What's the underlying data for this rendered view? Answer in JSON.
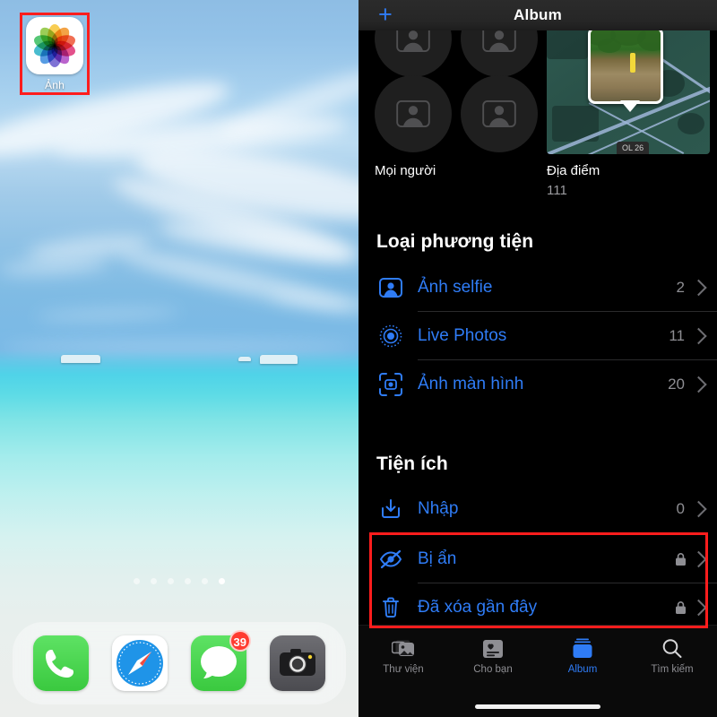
{
  "home_screen": {
    "app_icon": {
      "name": "photos-app-icon",
      "label": "Ảnh"
    },
    "highlight_color": "#ff1d1d",
    "page_dots": {
      "total": 6,
      "active_index": 5
    },
    "dock": {
      "items": [
        {
          "name": "phone",
          "icon": "phone-icon",
          "badge": ""
        },
        {
          "name": "safari",
          "icon": "safari-compass-icon",
          "badge": ""
        },
        {
          "name": "messages",
          "icon": "messages-bubble-icon",
          "badge": "39"
        },
        {
          "name": "camera",
          "icon": "camera-icon",
          "badge": ""
        }
      ]
    },
    "wallpaper": {
      "description": "beach-sea-sky",
      "sky_color": "#8ebde4",
      "sea_color": "#4fd3e8",
      "sand_color": "#eceeec"
    }
  },
  "photos_app": {
    "nav": {
      "add_label": "+",
      "title": "Album"
    },
    "top_albums": [
      {
        "name": "people-album",
        "caption": "Mọi người",
        "count": ""
      },
      {
        "name": "places-album",
        "caption": "Địa điểm",
        "count": "111",
        "map_label": "OL 26"
      }
    ],
    "sections": [
      {
        "name": "media-types",
        "title": "Loại phương tiện",
        "rows": [
          {
            "icon": "selfie-icon",
            "label": "Ảnh selfie",
            "count": "2",
            "locked": false
          },
          {
            "icon": "live-photo-icon",
            "label": "Live Photos",
            "count": "11",
            "locked": false
          },
          {
            "icon": "screenshot-icon",
            "label": "Ảnh màn hình",
            "count": "20",
            "locked": false
          }
        ]
      },
      {
        "name": "utilities",
        "title": "Tiện ích",
        "rows": [
          {
            "icon": "import-icon",
            "label": "Nhập",
            "count": "0",
            "locked": false
          },
          {
            "icon": "eye-slash-icon",
            "label": "Bị ẩn",
            "count": "",
            "locked": true
          },
          {
            "icon": "trash-icon",
            "label": "Đã xóa gần đây",
            "count": "",
            "locked": true
          }
        ]
      }
    ],
    "accent_color": "#2f7cf6",
    "tabs": [
      {
        "name": "library",
        "label": "Thư viện",
        "icon": "photo-stack-icon",
        "active": false
      },
      {
        "name": "for-you",
        "label": "Cho bạn",
        "icon": "for-you-card-icon",
        "active": false
      },
      {
        "name": "albums",
        "label": "Album",
        "icon": "albums-stack-icon",
        "active": true
      },
      {
        "name": "search",
        "label": "Tìm kiếm",
        "icon": "search-icon",
        "active": false
      }
    ]
  }
}
